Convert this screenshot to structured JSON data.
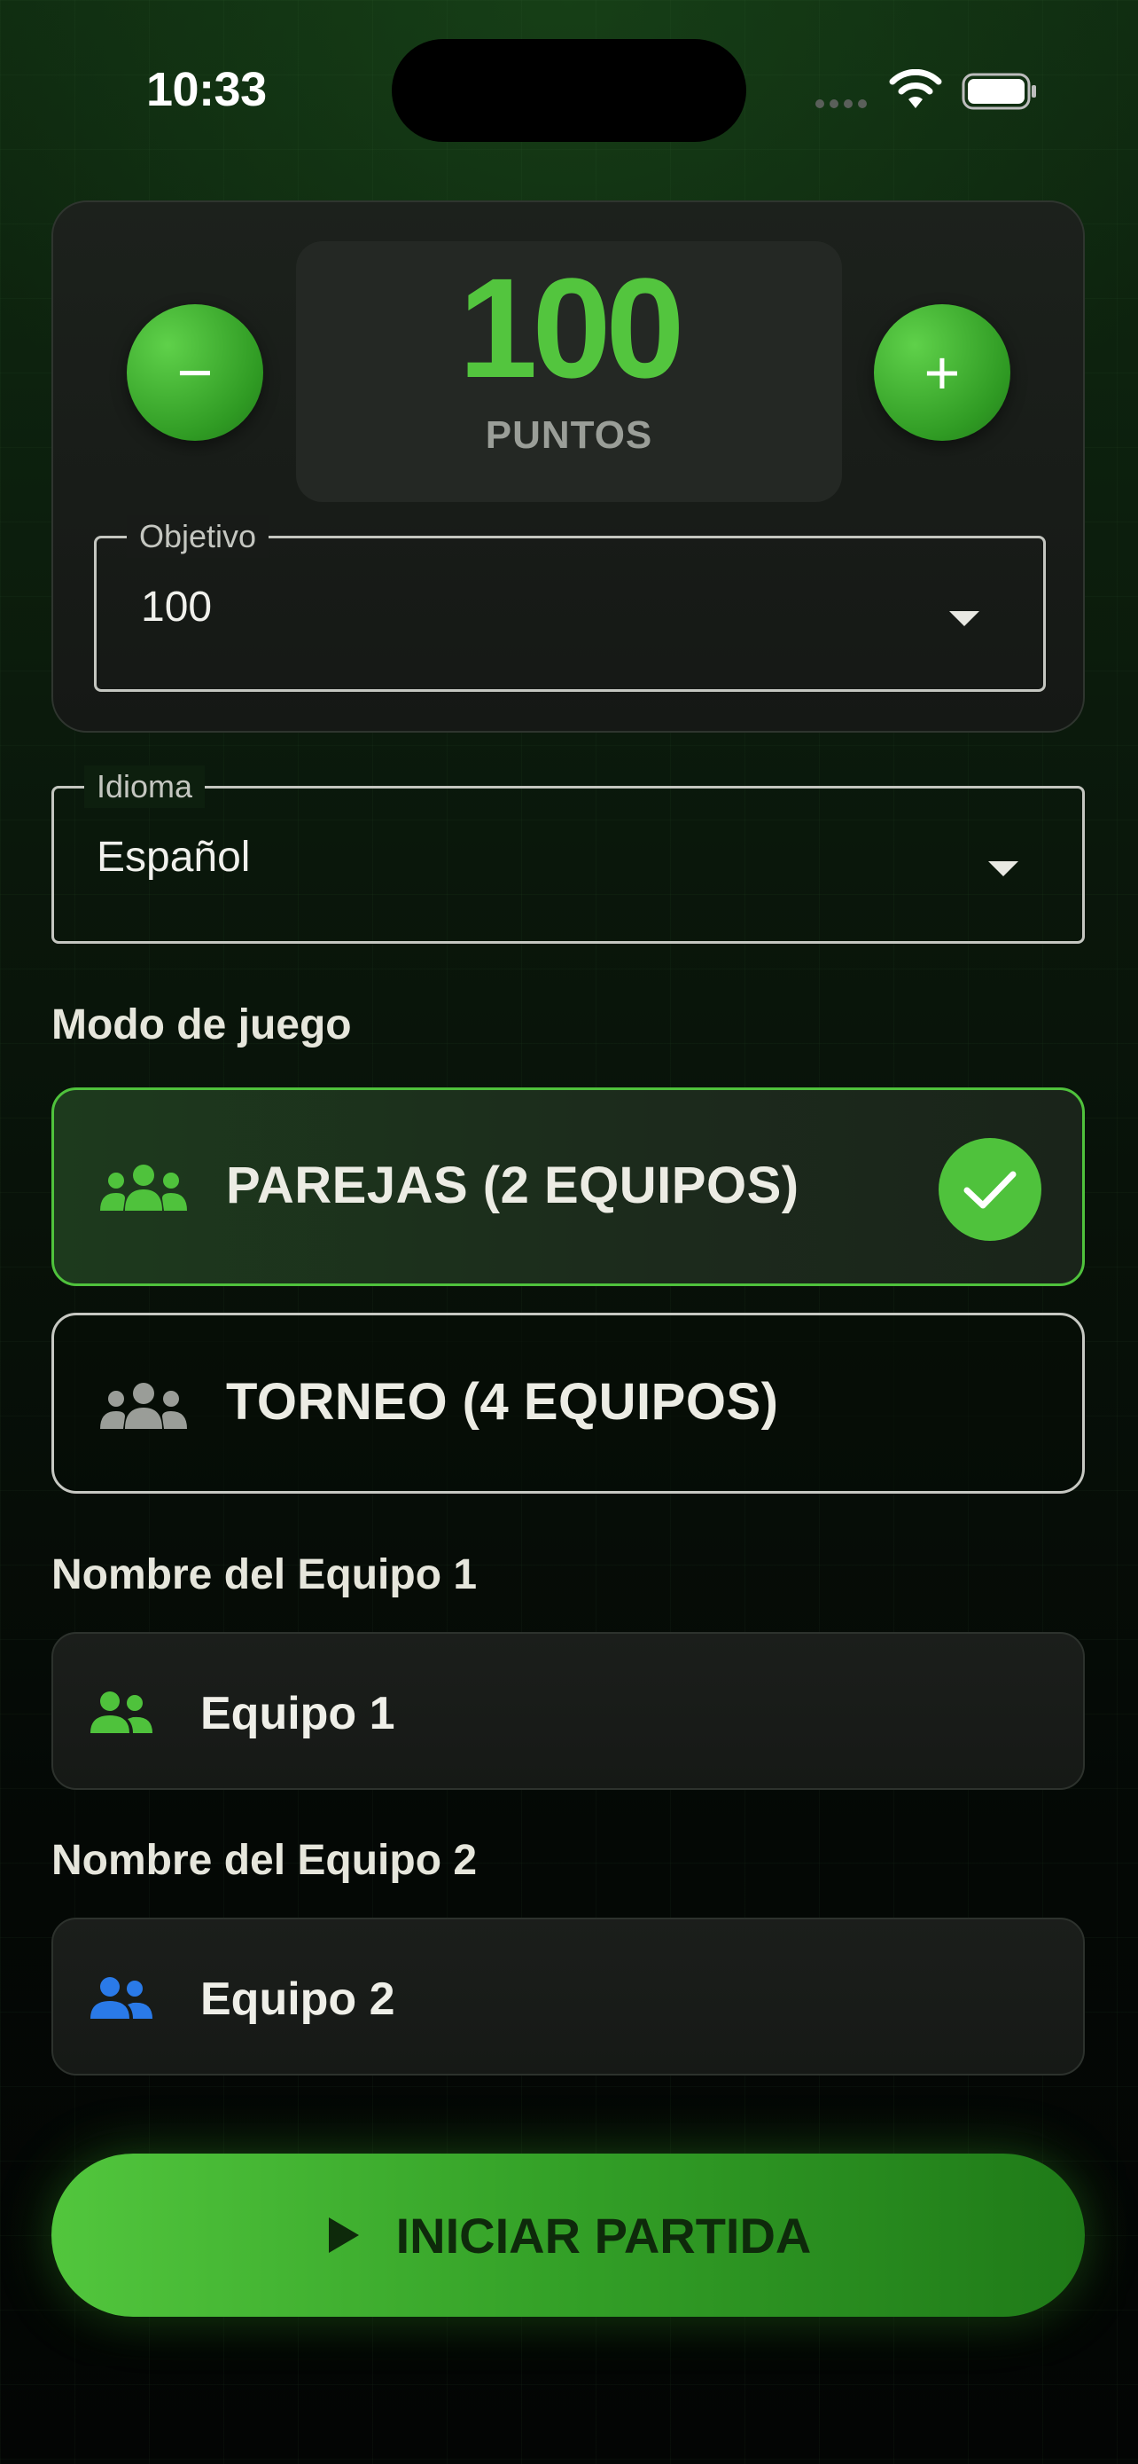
{
  "status_bar": {
    "time": "10:33"
  },
  "points": {
    "value": "100",
    "unit_label": "PUNTOS",
    "decrement_label": "−",
    "increment_label": "+"
  },
  "objetivo_select": {
    "label": "Objetivo",
    "value": "100"
  },
  "idioma_select": {
    "label": "Idioma",
    "value": "Español"
  },
  "game_mode": {
    "heading": "Modo de juego",
    "options": [
      {
        "label": "PAREJAS (2 EQUIPOS)",
        "selected": true,
        "icon": "group-icon"
      },
      {
        "label": "TORNEO (4 EQUIPOS)",
        "selected": false,
        "icon": "group-icon"
      }
    ]
  },
  "team1": {
    "heading": "Nombre del Equipo 1",
    "value": "Equipo 1",
    "icon": "people-icon",
    "color": "#4fc23c"
  },
  "team2": {
    "heading": "Nombre del Equipo 2",
    "value": "Equipo 2",
    "icon": "people-icon",
    "color": "#2a7ae8"
  },
  "start_button": {
    "label": "INICIAR PARTIDA",
    "icon": "play-icon"
  },
  "colors": {
    "accent": "#4fc23c",
    "background": "#0a170b"
  }
}
